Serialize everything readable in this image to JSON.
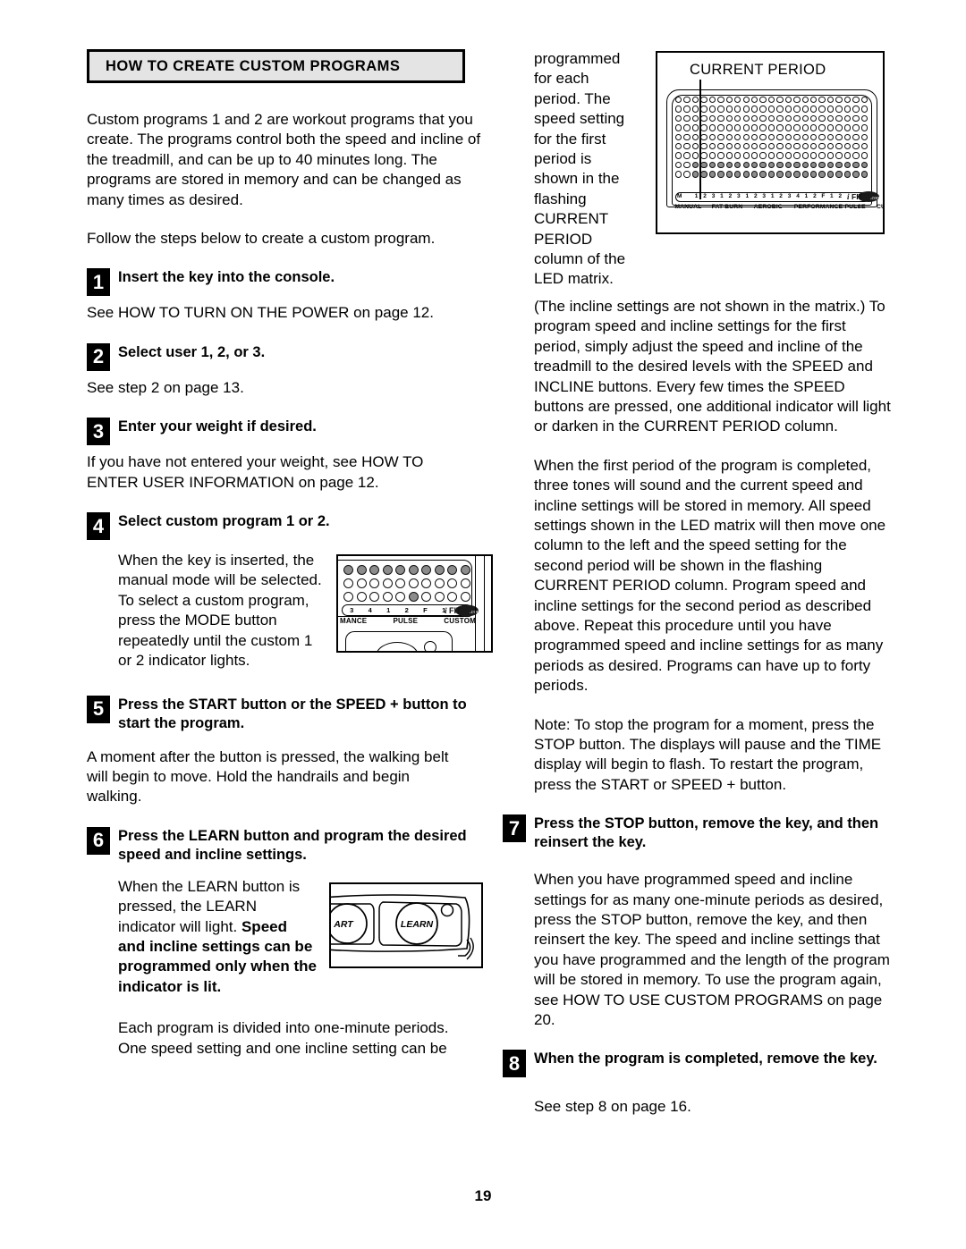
{
  "page": {
    "number": "19"
  },
  "header": {
    "title": "HOW TO CREATE CUSTOM PROGRAMS"
  },
  "left_column": {
    "intro_paragraph": "Custom programs 1 and 2 are workout programs that you create. The programs control both the speed and incline of the treadmill, and can be up to 40 minutes long. The programs are stored in memory and can be changed as many times as desired.",
    "follow_paragraph": "Follow the steps below to create a custom program.",
    "steps": [
      {
        "number": "1",
        "title": "Insert the key into the console.",
        "body": "See HOW TO TURN ON THE POWER on page 12."
      },
      {
        "number": "2",
        "title": "Select user 1, 2, or 3.",
        "body": "See step 2 on page 13."
      },
      {
        "number": "3",
        "title": "Enter your weight if desired.",
        "body": "If you have not entered your weight, see HOW TO ENTER USER INFORMATION on page 12."
      },
      {
        "number": "4",
        "title": "Select custom program 1 or 2.",
        "body": "When the key is inserted, the manual mode will be selected. To select a custom program, press the MODE button repeatedly until the custom 1 or 2 indicator lights."
      },
      {
        "number": "5",
        "title": "Press the START button or the SPEED + button to start the program.",
        "body": "A moment after the button is pressed, the walking belt will begin to move. Hold the handrails and begin walking."
      },
      {
        "number": "6",
        "title": "Press the LEARN button and program the desired speed and incline settings.",
        "body_plain": "When the LEARN button is pressed, the LEARN indicator will light.",
        "body_bold": "Speed and incline settings can be programmed only when the indicator is lit."
      }
    ],
    "closing_paragraph": "Each program is divided into one-minute periods. One speed setting and one incline setting can be"
  },
  "right_column": {
    "continuation_paragraph": "programmed for each period. The speed setting for the first period is shown in the flashing CURRENT PERIOD column of the LED matrix.",
    "paragraph_2": "(The incline settings are not shown in the matrix.) To program speed and incline settings for the first period, simply adjust the speed and incline of the treadmill to the desired levels with the SPEED and INCLINE buttons. Every few times the SPEED buttons are pressed, one additional indicator will light or darken in the CURRENT PERIOD column.",
    "paragraph_3": "When the first period of the program is completed, three tones will sound and the current speed and incline settings will be stored in memory. All speed settings shown in the LED matrix will then move one column to the left and the speed setting for the second period will be shown in the flashing CURRENT PERIOD column. Program speed and incline settings for the second period as described above. Repeat this procedure until you have programmed speed and incline settings for as many periods as desired. Programs can have up to forty periods.",
    "note_paragraph": "Note: To stop the program for a moment, press the STOP button. The displays will pause and the TIME display will begin to flash. To restart the program, press the START or SPEED + button.",
    "steps": [
      {
        "number": "7",
        "title": "Press the STOP button, remove the key, and then reinsert the key.",
        "body": "When you have programmed speed and incline settings for as many one-minute periods as desired, press the STOP button, remove the key, and then reinsert the key. The speed and incline settings that you have programmed and the length of the program will be stored in memory. To use the program again, see HOW TO USE CUSTOM PROGRAMS on page 20."
      },
      {
        "number": "8",
        "title": "When the program is completed, remove the key.",
        "body": "See step 8 on page 16."
      }
    ]
  },
  "figures": {
    "current_period": {
      "caption": "CURRENT PERIOD",
      "matrix_rows": 9,
      "matrix_cols": 23,
      "lit_rows": [
        7,
        8
      ],
      "indicator_numbers": [
        "M",
        "",
        "1",
        "2",
        "3",
        "1",
        "2",
        "3",
        "1",
        "2",
        "3",
        "1",
        "2",
        "3",
        "4",
        "1",
        "2",
        "F",
        "1",
        "2",
        "",
        "",
        ""
      ],
      "group_labels": [
        "MANUAL",
        "FAT BURN",
        "AEROBIC",
        "PERFORMANCE",
        "PULSE",
        "CUSTOM"
      ],
      "logo": "iFIT.com"
    },
    "console_detail": {
      "indicator_numbers": [
        "3",
        "4",
        "1",
        "2",
        "F",
        "1",
        "2"
      ],
      "group_labels": [
        "MANCE",
        "PULSE",
        "CUSTOM"
      ],
      "logo": "iFIT.com",
      "rows": 3,
      "cols": 10
    },
    "learn_detail": {
      "start_button_label": "ART",
      "learn_button_label": "LEARN"
    }
  }
}
